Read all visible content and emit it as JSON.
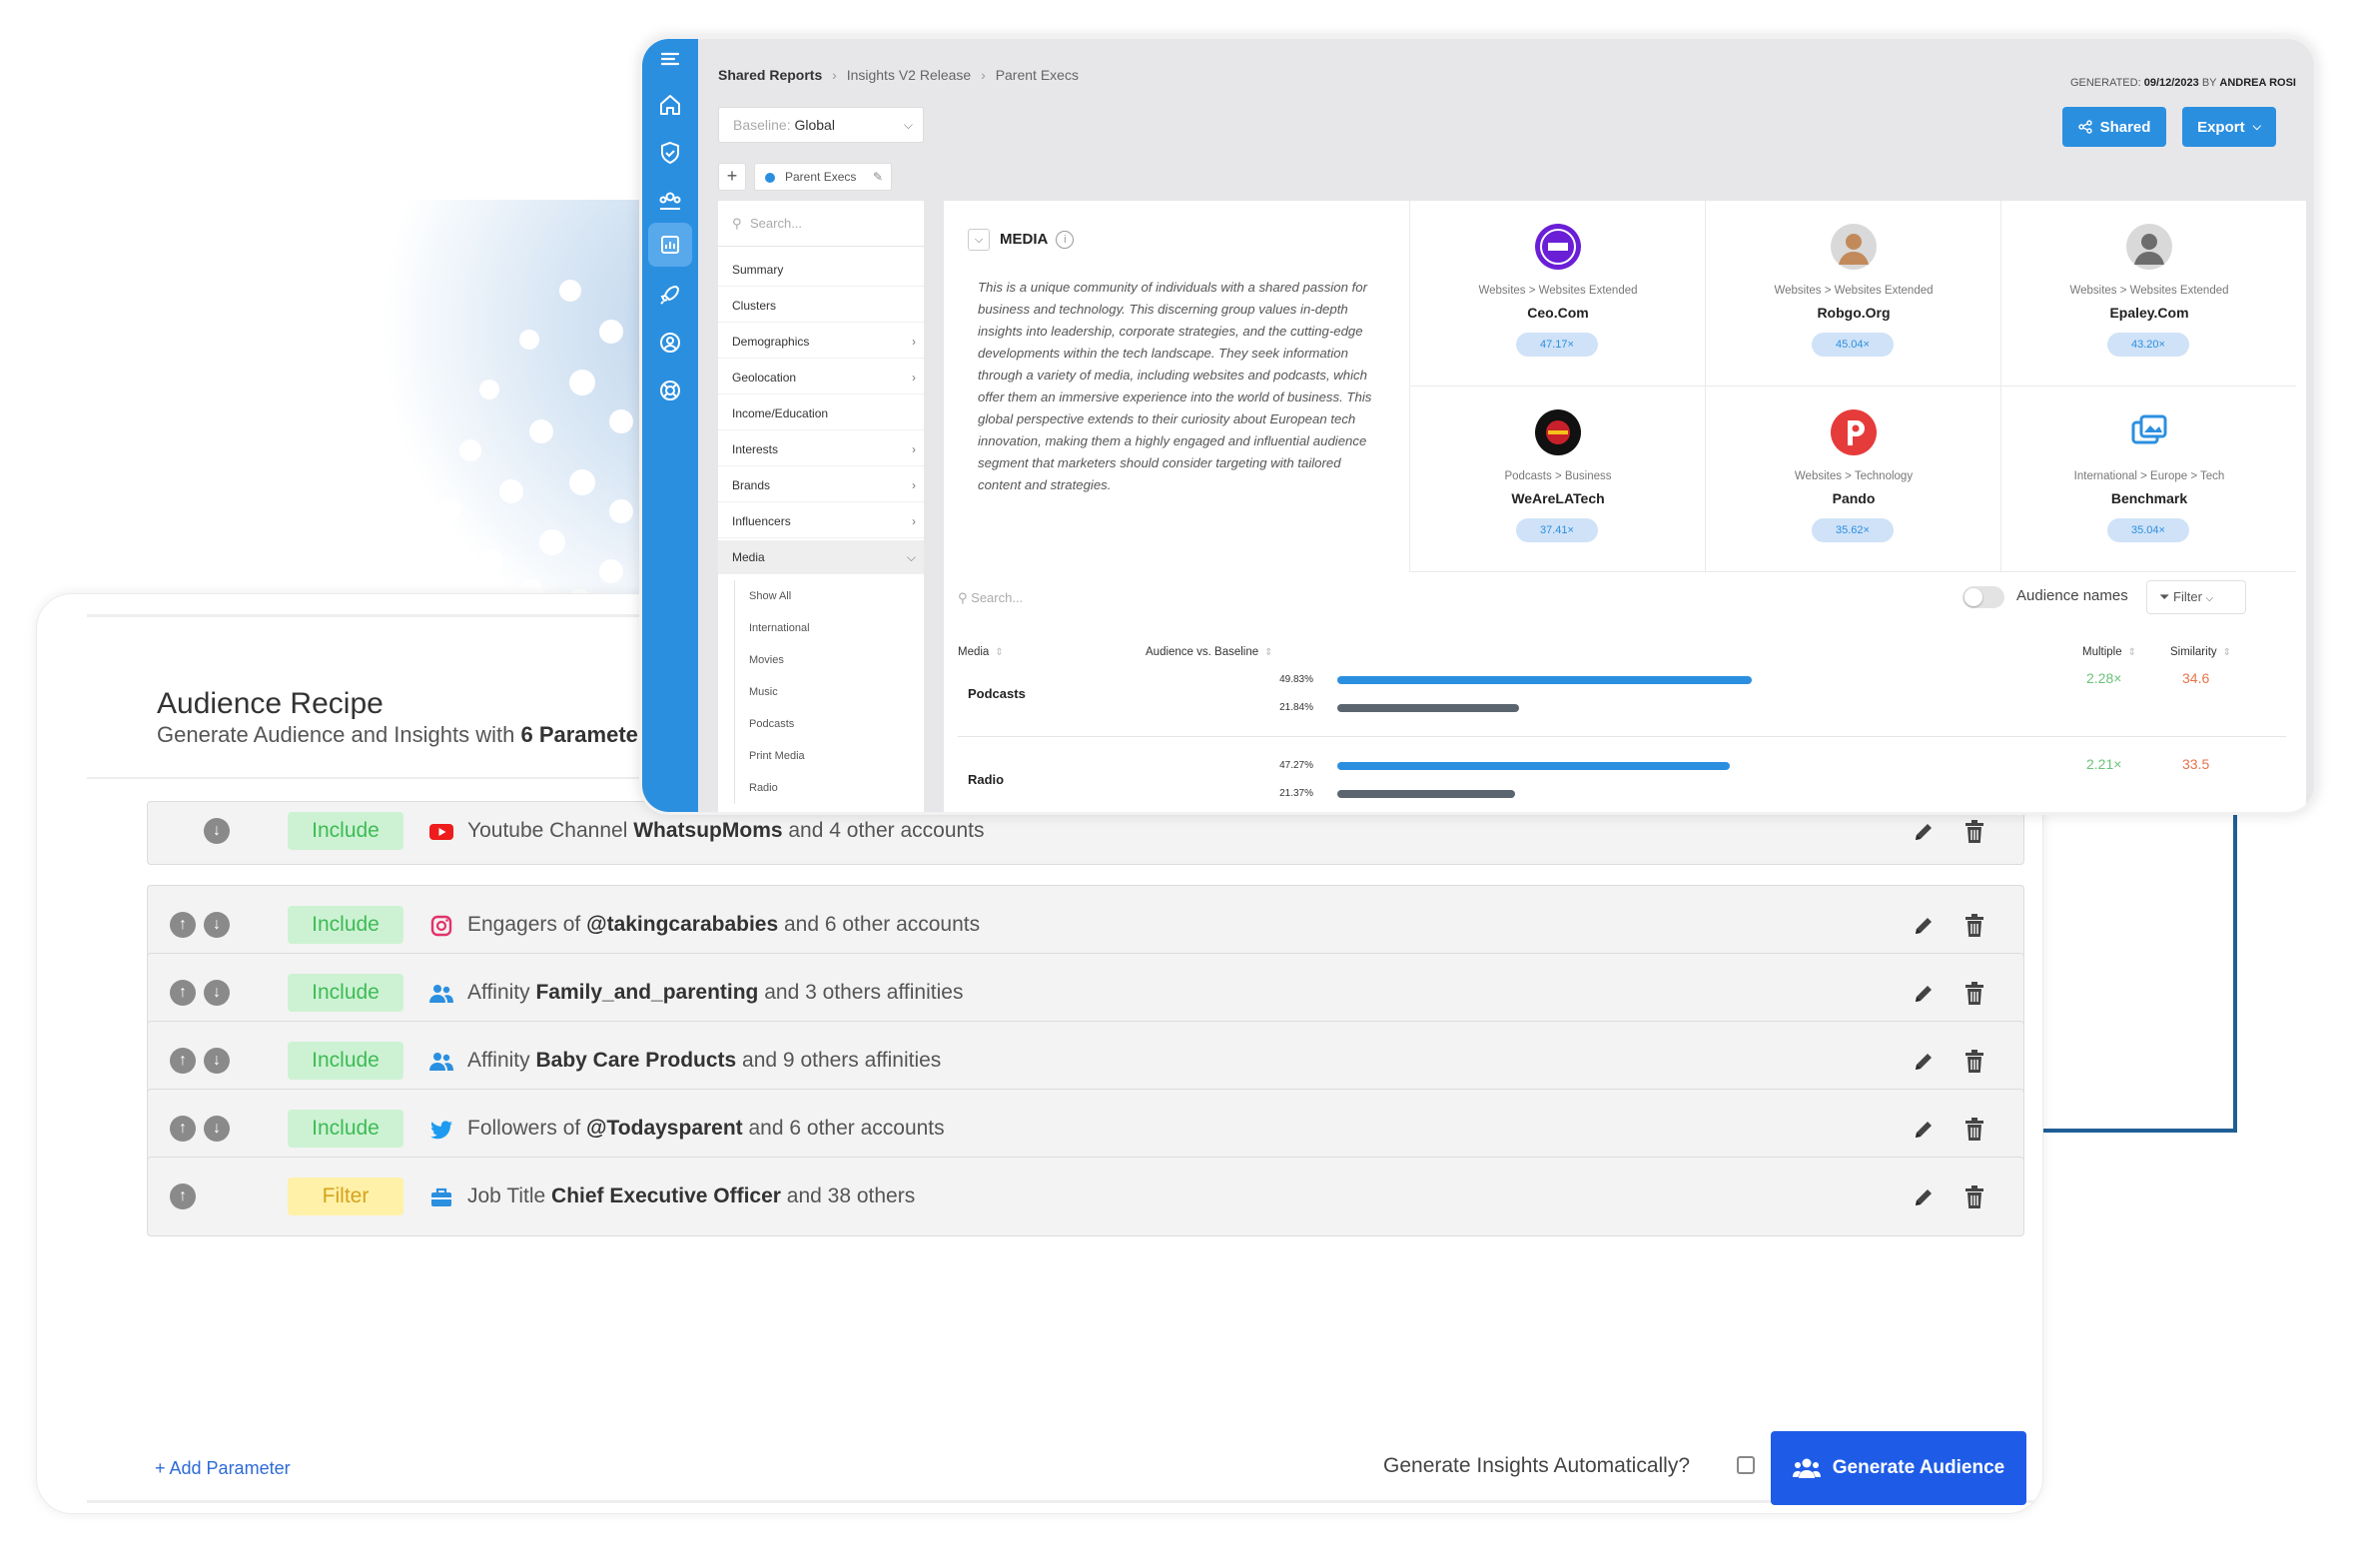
{
  "recipe": {
    "title": "Audience Recipe",
    "subtitle_prefix": "Generate Audience and Insights with ",
    "subtitle_bold": "6 Parameters",
    "params": [
      {
        "badge": "Include",
        "pre": "Youtube Channel ",
        "bold": "WhatsupMoms",
        "post": " and 4 other accounts",
        "icon": "youtube-icon"
      },
      {
        "badge": "Include",
        "pre": "Engagers of ",
        "bold": "@takingcarababies",
        "post": " and 6 other accounts",
        "icon": "instagram-icon"
      },
      {
        "badge": "Include",
        "pre": "Affinity ",
        "bold": "Family_and_parenting",
        "post": " and 3 others affinities",
        "icon": "people-icon"
      },
      {
        "badge": "Include",
        "pre": "Affinity ",
        "bold": "Baby Care Products",
        "post": " and 9 others affinities",
        "icon": "people-icon"
      },
      {
        "badge": "Include",
        "pre": "Followers of ",
        "bold": "@Todaysparent",
        "post": " and 6 other accounts",
        "icon": "twitter-icon"
      },
      {
        "badge": "Filter",
        "pre": "Job Title ",
        "bold": "Chief Executive Officer",
        "post": " and 38 others",
        "icon": "briefcase-icon"
      }
    ],
    "add_parameter": "+ Add Parameter",
    "generate_auto": "Generate Insights Automatically?",
    "generate_button": "Generate Audience"
  },
  "insights": {
    "breadcrumb": [
      "Shared Reports",
      "Insights V2 Release",
      "Parent Execs"
    ],
    "generated_label": "GENERATED:",
    "generated_date": "09/12/2023",
    "generated_by_label": "BY",
    "generated_by": "ANDREA ROSI",
    "shared_button": "Shared",
    "export_button": "Export",
    "baseline_label": "Baseline:",
    "baseline_value": "Global",
    "segment_tab": "Parent Execs",
    "menu_search": "Search...",
    "menu": [
      {
        "label": "Summary",
        "arrow": false
      },
      {
        "label": "Clusters",
        "arrow": false
      },
      {
        "label": "Demographics",
        "arrow": true
      },
      {
        "label": "Geolocation",
        "arrow": true
      },
      {
        "label": "Income/Education",
        "arrow": false
      },
      {
        "label": "Interests",
        "arrow": true
      },
      {
        "label": "Brands",
        "arrow": true
      },
      {
        "label": "Influencers",
        "arrow": true
      },
      {
        "label": "Media",
        "arrow": true
      }
    ],
    "submenu": [
      "Show All",
      "International",
      "Movies",
      "Music",
      "Podcasts",
      "Print Media",
      "Radio"
    ],
    "media_title": "MEDIA",
    "media_description": "This is a unique community of individuals with a shared passion for business and technology. This discerning group values in-depth insights into leadership, corporate strategies, and the cutting-edge developments within the tech landscape. They seek information through a variety of media, including websites and podcasts, which offer them an immersive experience into the world of business. This global perspective extends to their curiosity about European tech innovation, making them a highly engaged and influential audience segment that marketers should consider targeting with tailored content and strategies.",
    "cards": [
      {
        "category": "Websites > Websites Extended",
        "name": "Ceo.Com",
        "value": "47.17×",
        "logo": "ceo-logo-icon",
        "color": "#6a1fd6"
      },
      {
        "category": "Websites > Websites Extended",
        "name": "Robgo.Org",
        "value": "45.04×",
        "logo": "avatar-icon",
        "color": "#c28a5b"
      },
      {
        "category": "Websites > Websites Extended",
        "name": "Epaley.Com",
        "value": "43.20×",
        "logo": "avatar-icon",
        "color": "#6d6d6d"
      },
      {
        "category": "Podcasts > Business",
        "name": "WeAreLATech",
        "value": "37.41×",
        "logo": "latech-logo-icon",
        "color": "#111111"
      },
      {
        "category": "Websites > Technology",
        "name": "Pando",
        "value": "35.62×",
        "logo": "pando-logo-icon",
        "color": "#e63b3b"
      },
      {
        "category": "International > Europe > Tech",
        "name": "Benchmark",
        "value": "35.04×",
        "logo": "benchmark-logo-icon",
        "color": "#2b8fe0"
      }
    ],
    "table_search": "Search...",
    "audience_names": "Audience names",
    "filter_label": "Filter",
    "columns": [
      "Media",
      "Audience vs. Baseline",
      "Multiple",
      "Similarity"
    ],
    "rows": [
      {
        "name": "Podcasts",
        "audience_pct": "49.83%",
        "baseline_pct": "21.84%",
        "audience": 49.83,
        "baseline": 21.84,
        "multiple": "2.28×",
        "similarity": "34.6"
      },
      {
        "name": "Radio",
        "audience_pct": "47.27%",
        "baseline_pct": "21.37%",
        "audience": 47.27,
        "baseline": 21.37,
        "multiple": "2.21×",
        "similarity": "33.5"
      }
    ]
  },
  "colors": {
    "primary_blue": "#2b8fe0",
    "generate_blue": "#1e5ce8",
    "include_green": "#3dbb55",
    "filter_yellow": "#d6a21c",
    "multiple_green": "#6bc37a",
    "similarity_orange": "#e8734a"
  }
}
